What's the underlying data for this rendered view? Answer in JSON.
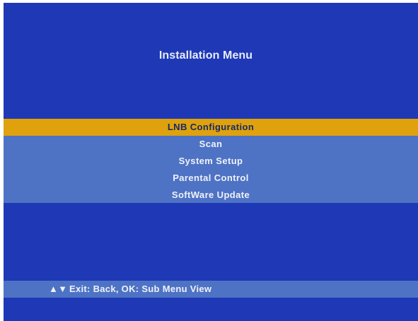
{
  "screen": {
    "title": "Installation Menu"
  },
  "menu": {
    "items": [
      {
        "label": "LNB Configuration",
        "selected": true
      },
      {
        "label": "Scan",
        "selected": false
      },
      {
        "label": "System Setup",
        "selected": false
      },
      {
        "label": "Parental Control",
        "selected": false
      },
      {
        "label": "SoftWare Update",
        "selected": false
      }
    ]
  },
  "help_bar": {
    "nav_icons": "▲▼",
    "text": "Exit: Back, OK: Sub Menu View"
  },
  "colors": {
    "background": "#1e38b6",
    "menu_band": "#4e73c4",
    "highlight": "#dfa20c"
  }
}
